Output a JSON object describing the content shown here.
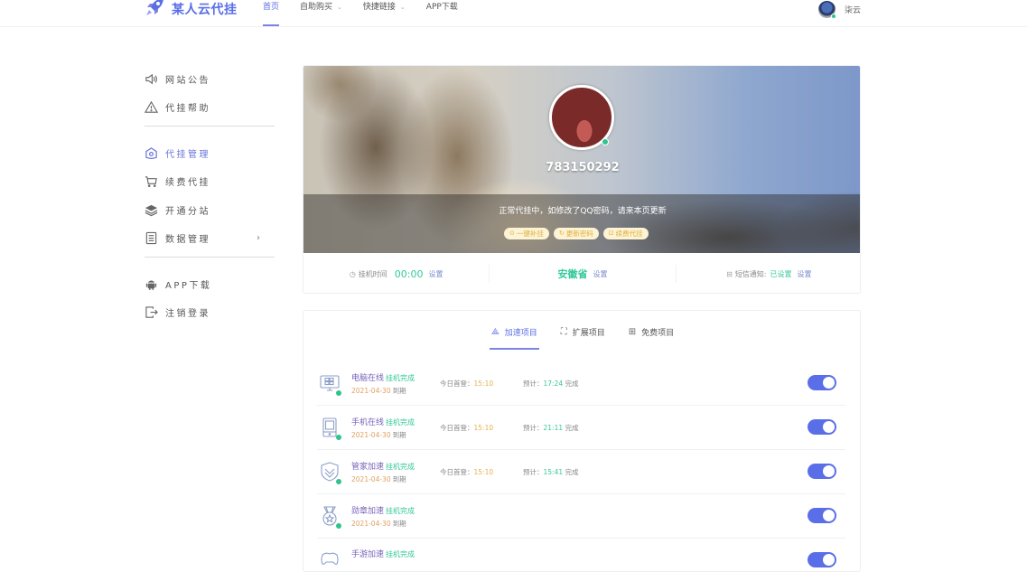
{
  "header": {
    "logo_text": "某人云代挂",
    "nav": [
      {
        "label": "首页",
        "active": true,
        "dropdown": false
      },
      {
        "label": "自助购买",
        "active": false,
        "dropdown": true
      },
      {
        "label": "快捷链接",
        "active": false,
        "dropdown": true
      },
      {
        "label": "APP下载",
        "active": false,
        "dropdown": false
      }
    ],
    "dropdown_glyph": "⌄",
    "user_name": "柒云"
  },
  "sidebar": {
    "group1": [
      {
        "label": "网站公告",
        "icon": "speaker-icon"
      },
      {
        "label": "代挂帮助",
        "icon": "warning-icon"
      }
    ],
    "group2": [
      {
        "label": "代挂管理",
        "icon": "home-shield-icon",
        "active": true
      },
      {
        "label": "续费代挂",
        "icon": "cart-icon"
      },
      {
        "label": "开通分站",
        "icon": "layers-icon"
      },
      {
        "label": "数据管理",
        "icon": "list-icon",
        "arrow": "›"
      }
    ],
    "group3": [
      {
        "label": "APP下载",
        "icon": "android-icon"
      },
      {
        "label": "注销登录",
        "icon": "logout-icon"
      }
    ]
  },
  "profile": {
    "qq": "783150292",
    "notice": "正常代挂中，如修改了QQ密码，请来本页更新",
    "buttons": [
      {
        "label": "一键补挂",
        "icon": "⊙"
      },
      {
        "label": "更新密码",
        "icon": "↻"
      },
      {
        "label": "续费代挂",
        "icon": "⊡"
      }
    ],
    "stats": {
      "hang_time_label": "挂机时间",
      "hang_time_value": "00:00",
      "hang_time_set": "设置",
      "region_value": "安徽省",
      "region_set": "设置",
      "sms_label": "短信通知:",
      "sms_value": "已设置",
      "sms_set": "设置"
    }
  },
  "projects": {
    "tabs": [
      {
        "label": "加速项目",
        "icon": "⟁",
        "active": true
      },
      {
        "label": "扩展项目",
        "icon": "⛶",
        "active": false
      },
      {
        "label": "免费项目",
        "icon": "⊞",
        "active": false
      }
    ],
    "first_login_label": "今日首登：",
    "eta_label": "预计：",
    "eta_suffix": "完成",
    "due_suffix": "到期",
    "rows": [
      {
        "name": "电脑在线",
        "status": "挂机完成",
        "date": "2021-04-30",
        "first_login": "15:10",
        "eta": "17:24",
        "enabled": true,
        "icon": "computer-icon"
      },
      {
        "name": "手机在线",
        "status": "挂机完成",
        "date": "2021-04-30",
        "first_login": "15:10",
        "eta": "21:11",
        "enabled": true,
        "icon": "phone-icon"
      },
      {
        "name": "管家加速",
        "status": "挂机完成",
        "date": "2021-04-30",
        "first_login": "15:10",
        "eta": "15:41",
        "enabled": true,
        "icon": "shield-icon"
      },
      {
        "name": "勋章加速",
        "status": "挂机完成",
        "date": "2021-04-30",
        "first_login": "",
        "eta": "",
        "enabled": true,
        "icon": "medal-icon"
      },
      {
        "name": "手游加速",
        "status": "挂机完成",
        "date": "",
        "first_login": "",
        "eta": "",
        "enabled": true,
        "icon": "gamepad-icon"
      }
    ]
  }
}
